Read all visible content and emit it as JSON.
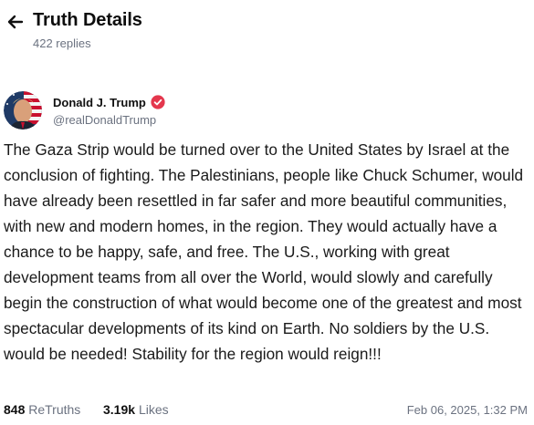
{
  "header": {
    "back_icon": "arrow-left-icon",
    "title": "Truth Details",
    "replies": "422 replies"
  },
  "author": {
    "display_name": "Donald J. Trump",
    "handle": "@realDonaldTrump",
    "verified_icon": "verified-badge-icon",
    "verified_color": "#e4374d"
  },
  "post": {
    "text": "The Gaza Strip would be turned over to the United States by Israel at the conclusion of fighting. The Palestinians, people like Chuck Schumer, would have already been resettled in far safer and more beautiful communities, with new and modern homes, in the region. They would actually have a chance to be happy, safe, and free. The U.S., working with great development teams from all over the World, would slowly and carefully begin the construction of what would become one of the greatest and most spectacular developments of its kind on Earth. No soldiers by the U.S. would be needed! Stability for the region would reign!!!"
  },
  "stats": {
    "retruths_count": "848",
    "retruths_label": "ReTruths",
    "likes_count": "3.19k",
    "likes_label": "Likes"
  },
  "timestamp": "Feb 06, 2025, 1:32 PM"
}
